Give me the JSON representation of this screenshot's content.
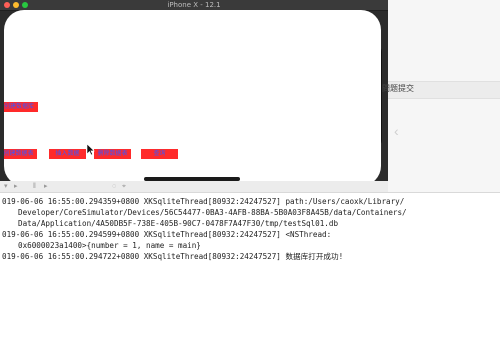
{
  "window": {
    "title": "iPhone X - 12.1"
  },
  "background_app": {
    "right_pane_text": "問题提交"
  },
  "app": {
    "top_button_label": "创建数据库",
    "buttons": [
      {
        "label": "创建数据表"
      },
      {
        "label": "插入数据"
      },
      {
        "label": "删除数据表"
      },
      {
        "label": "查询"
      }
    ],
    "button_bg": "#ff2a2a",
    "button_text_color": "#3a56ff"
  },
  "icons": {
    "cursor": "arrow-cursor-icon",
    "right_tab": "chevron-left-icon"
  },
  "console": {
    "lines": [
      "019-06-06 16:55:00.294359+0800 XKSqliteThread[80932:24247527] path:/Users/caoxk/Library/",
      "Developer/CoreSimulator/Devices/56C54477-0BA3-4AFB-88BA-5B0A03F8A45B/data/Containers/",
      "Data/Application/4A50DB5F-738E-405B-90C7-0478F7A47F30/tmp/testSql01.db",
      "019-06-06 16:55:00.294599+0800 XKSqliteThread[80932:24247527] <NSThread:",
      "0x6000023a1400>{number = 1, name = main}",
      "019-06-06 16:55:00.294722+0800 XKSqliteThread[80932:24247527] 数据库打开成功!"
    ]
  }
}
